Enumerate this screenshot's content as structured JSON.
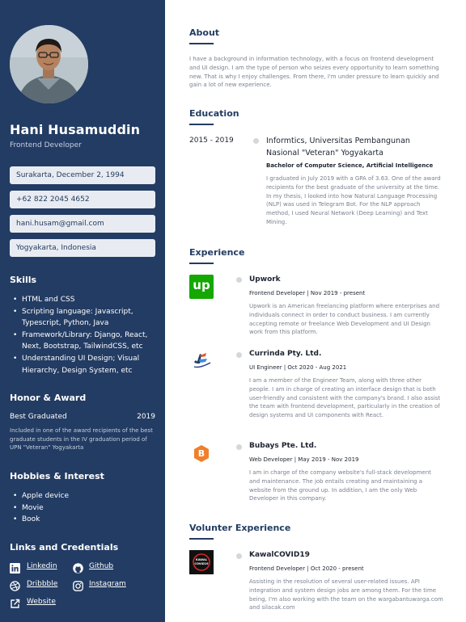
{
  "profile": {
    "name": "Hani Husamuddin",
    "role": "Frontend Developer"
  },
  "contact": {
    "birth": "Surakarta,  December 2, 1994",
    "phone": "+62 822 2045 4652",
    "email": "hani.husam@gmail.com",
    "location": "Yogyakarta, Indonesia"
  },
  "skills": {
    "heading": "Skills",
    "items": [
      "HTML and CSS",
      "Scripting language: Javascript, Typescript, Python, Java",
      "Framework/Library: Django, React, Next, Bootstrap, TailwindCSS, etc",
      "Understanding UI Design; Visual Hierarchy, Design System, etc"
    ]
  },
  "honor": {
    "heading": "Honor & Award",
    "title": "Best Graduated",
    "year": "2019",
    "description": "Included in one of the award recipients of the best graduate students in the IV graduation period of UPN \"Veteran\" Yogyakarta"
  },
  "hobbies": {
    "heading": "Hobbies & Interest",
    "items": [
      "Apple device",
      "Movie",
      "Book"
    ]
  },
  "links": {
    "heading": "Links and Credentials",
    "linkedin": "Linkedin",
    "github": "Github",
    "dribbble": "Dribbble",
    "instagram": "Instagram",
    "website": "Website"
  },
  "about": {
    "heading": "About",
    "text": "I have a background in information technology, with a focus on frontend development and UI design. I am the type of person who seizes every opportunity to learn something new. That is why I enjoy challenges. From there, I'm under pressure to learn quickly and gain a lot of new experience."
  },
  "education": {
    "heading": "Education",
    "years": "2015 - 2019",
    "school": "Informtics, Universitas Pembangunan Nasional \"Veteran\" Yogyakarta",
    "degree": "Bachelor of Computer Science, Artificial Intelligence",
    "text": "I graduated in July 2019 with a GPA of 3.63. One of the award recipients for the best graduate of the university at the time. In my thesis, I looked into how Natural Language Processing (NLP) was used in Telegram Bot. For the NLP approach method, I used Neural Network (Deep Learning) and Text Mining."
  },
  "experience": {
    "heading": "Experience",
    "items": [
      {
        "company": "Upwork",
        "logo_text": "up",
        "subtitle": "Frontend Developer  |  Nov 2019 - present",
        "text": "Upwork is an American freelancing platform where enterprises and individuals connect in order to conduct business. I am currently accepting remote or freelance Web Development and UI Design work from this platform."
      },
      {
        "company": "Currinda Pty. Ltd.",
        "subtitle": "UI Engineer  |  Oct 2020 - Aug 2021",
        "text": "I am a member of the Engineer Team, along with three other people. I am in charge of creating an interface design that is both user-friendly and consistent with the company's brand. I also assist the team with frontend development, particularly in the creation of design systems and UI components with React."
      },
      {
        "company": "Bubays Pte. Ltd.",
        "logo_text": "B",
        "subtitle": "Web Developer  |  May 2019 - Nov 2019",
        "text": "I am in charge of the company website's full-stack development and maintenance. The job entails creating and maintaining a website from the ground up. In addition, I am the only Web Developer in this company."
      }
    ]
  },
  "volunteer": {
    "heading": "Volunter Experience",
    "company": "KawalCOVID19",
    "logo_text": "KAWAL COVID19",
    "subtitle": "Frontend Developer  |  Oct 2020 - present",
    "text": "Assisting in the resolution of several user-related issues. API integration and system design jobs are among them. For the time being, I'm also working with the team on the wargabantuwarga.com and silacak.com"
  },
  "colors": {
    "sidebar": "#233c63",
    "upwork": "#14a800",
    "bubays": "#f07f2c"
  }
}
